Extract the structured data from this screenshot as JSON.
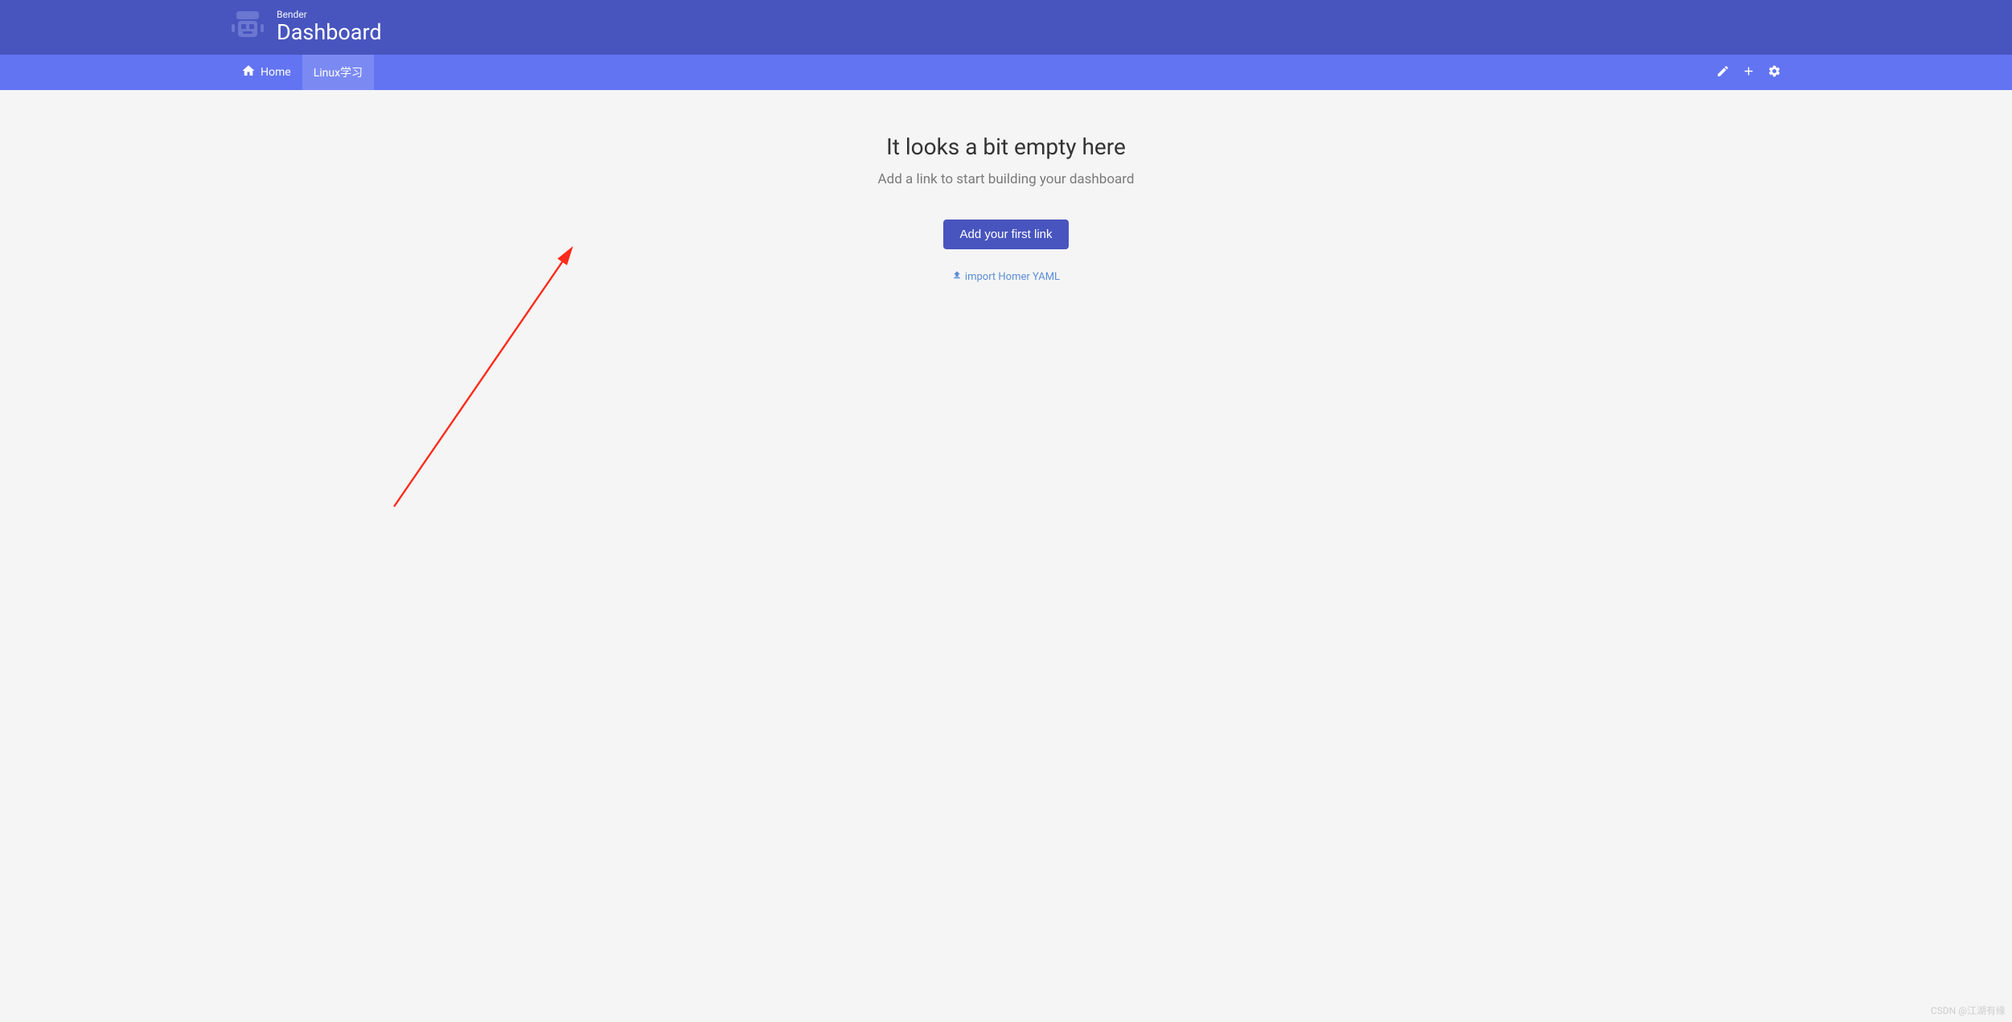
{
  "header": {
    "subtitle": "Bender",
    "title": "Dashboard"
  },
  "nav": {
    "items": [
      {
        "label": "Home"
      },
      {
        "label": "Linux学习"
      }
    ]
  },
  "empty": {
    "title": "It looks a bit empty here",
    "subtitle": "Add a link to start building your dashboard",
    "button": "Add your first link",
    "import_link": "import Homer YAML"
  },
  "watermark": "CSDN @江湖有缘"
}
